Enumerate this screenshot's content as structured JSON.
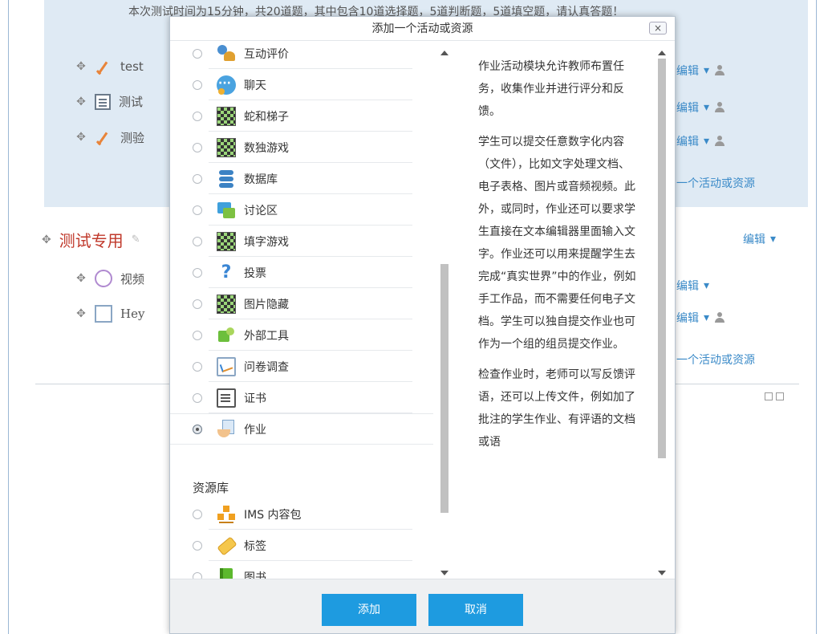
{
  "background": {
    "intro": "本次测试时间为15分钟，共20道题，其中包含10道选择题，5道判断题，5道填空题，请认真答题！",
    "section1_items": [
      {
        "label": "test",
        "icon": "quiz-check-icon"
      },
      {
        "label": "测试",
        "icon": "page-icon"
      },
      {
        "label": "测验",
        "icon": "quiz-check-icon"
      }
    ],
    "edit_label": "编辑",
    "add_activity_link": "一个活动或资源",
    "section2_title": "测试专用",
    "section2_edit": "编辑",
    "section2_items": [
      {
        "label": "视频",
        "icon": "video-icon"
      },
      {
        "label": "Hey",
        "icon": "survey-icon"
      }
    ]
  },
  "modal": {
    "title": "添加一个活动或资源",
    "close_label": "×",
    "activities": [
      {
        "label": "互动评价",
        "icon": "workshop-icon"
      },
      {
        "label": "聊天",
        "icon": "chat-icon"
      },
      {
        "label": "蛇和梯子",
        "icon": "game-board-icon"
      },
      {
        "label": "数独游戏",
        "icon": "game-board-icon"
      },
      {
        "label": "数据库",
        "icon": "database-icon"
      },
      {
        "label": "讨论区",
        "icon": "forum-icon"
      },
      {
        "label": "填字游戏",
        "icon": "game-board-icon"
      },
      {
        "label": "投票",
        "icon": "question-icon"
      },
      {
        "label": "图片隐藏",
        "icon": "game-board-icon"
      },
      {
        "label": "外部工具",
        "icon": "puzzle-icon"
      },
      {
        "label": "问卷调查",
        "icon": "survey-icon"
      },
      {
        "label": "证书",
        "icon": "certificate-icon"
      },
      {
        "label": "作业",
        "icon": "assignment-icon",
        "selected": true
      }
    ],
    "resources_heading": "资源库",
    "resources": [
      {
        "label": "IMS 内容包",
        "icon": "ims-package-icon"
      },
      {
        "label": "标签",
        "icon": "label-icon"
      },
      {
        "label": "图书",
        "icon": "book-icon"
      },
      {
        "label": "",
        "icon": "page-icon"
      }
    ],
    "description": [
      "作业活动模块允许教师布置任务，收集作业并进行评分和反馈。",
      "学生可以提交任意数字化内容（文件），比如文字处理文档、电子表格、图片或音频视频。此外，或同时，作业还可以要求学生直接在文本编辑器里面输入文字。作业还可以用来提醒学生去完成“真实世界”中的作业，例如手工作品，而不需要任何电子文档。学生可以独自提交作业也可作为一个组的组员提交作业。",
      "检查作业时，老师可以写反馈评语，还可以上传文件，例如加了批注的学生作业、有评语的文档或语"
    ],
    "add_button": "添加",
    "cancel_button": "取消"
  }
}
